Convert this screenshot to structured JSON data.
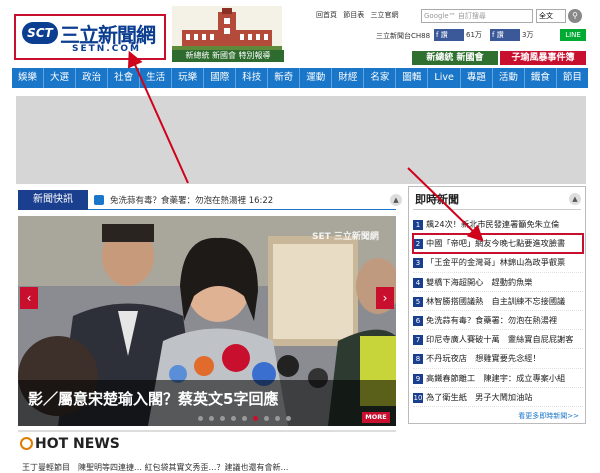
{
  "header": {
    "logo_sct": "SCT",
    "logo_name": "三立新聞網",
    "logo_url": "SETN.COM",
    "banner_caption": "新總統 新國會 特別報導",
    "top_links": [
      "回首頁",
      "節目表",
      "三立官網"
    ],
    "search_placeholder": "Google™ 自訂搜尋",
    "search_scope": "全文",
    "channel": "三立新聞台CH88",
    "facebook_label": "f 讚",
    "facebook_count": "61万",
    "facebook_label_2": "f 讚",
    "facebook_count_2": "3万",
    "line_label": "LINE",
    "promo_1": "新總統 新國會",
    "promo_2": "子瑜風暴事件簿"
  },
  "nav": {
    "items": [
      "娛樂",
      "大選",
      "政治",
      "社會",
      "生活",
      "玩樂",
      "國際",
      "科技",
      "新奇",
      "運動",
      "財經",
      "名家",
      "圖輯",
      "Live",
      "專題",
      "活動",
      "鐵食",
      "節目"
    ]
  },
  "flash": {
    "title": "新聞快訊",
    "headline": "免洗蒜有毒？食藥署：勿泡在熱湯裡 16:22"
  },
  "slider": {
    "caption": "影／屬意宋楚瑜入閣？蔡英文5字回應",
    "more_label": "MORE",
    "watermark": "SET 三立新聞網",
    "prev_icon": "‹",
    "next_icon": "›",
    "dot_count": 9,
    "active_dot": 5
  },
  "hot_news": {
    "title": "HOT NEWS",
    "row": "王丁曼輕節目　陳聖明等四連捷…       紅包袋其實文秀歪…？建議也還有會新…"
  },
  "instant": {
    "title": "即時新聞",
    "items": [
      "飆24次！新北市民發連署籲免朱立倫",
      "中國「帝吧」網友今晚七點要進攻臉書",
      "「王金平的金灣哥」林錦山為政爭叡票",
      "雙橋下海超開心　趕動釣魚樂",
      "林智勝搭國議熱　自主訓練不忘接國議",
      "免洗蒜有毒？食藥署：勿泡在熱湯裡",
      "印尼寺廣人賽破十萬　靈絲實自屁屁謝客",
      "不丹玩夜店　想雞實要先念經！",
      "高鐵春節離工　陳建宇：成立專案小組",
      "為了衛生紙　男子大鬧加油站"
    ],
    "highlight_index": 1,
    "more": "看更多即時新聞>>"
  },
  "colors": {
    "nav_blue": "#1976c8",
    "accent_red": "#c8102e",
    "brand_navy": "#0b3d91"
  }
}
